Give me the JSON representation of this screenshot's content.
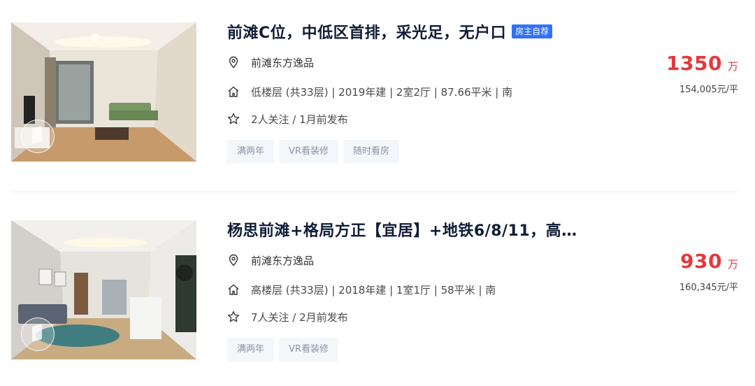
{
  "listings": [
    {
      "title": "前滩C位，中低区首排，采光足，无户口",
      "owner_tag": "房主自荐",
      "community": "前滩东方逸品",
      "house_info": "低楼层 (共33层) | 2019年建 | 2室2厅 | 87.66平米 | 南",
      "follow_info": "2人关注 / 1月前发布",
      "tags": [
        "满两年",
        "VR看装修",
        "随时看房"
      ],
      "total_price": "1350",
      "total_unit": "万",
      "unit_price": "154,005元/平"
    },
    {
      "title": "杨思前滩+格局方正【宜居】+地铁6/8/11，高…",
      "owner_tag": "",
      "community": "前滩东方逸品",
      "house_info": "高楼层 (共33层) | 2018年建 | 1室1厅 | 58平米 | 南",
      "follow_info": "7人关注 / 2月前发布",
      "tags": [
        "满两年",
        "VR看装修"
      ],
      "total_price": "930",
      "total_unit": "万",
      "unit_price": "160,345元/平"
    }
  ],
  "icons": {
    "location": "location-pin-icon",
    "house": "house-icon",
    "follow": "star-icon",
    "vr": "vr-icon"
  },
  "colors": {
    "price": "#e4393c",
    "owner_tag_bg": "#3072f6",
    "title": "#101d37",
    "tag_bg": "#f4f7f9"
  }
}
